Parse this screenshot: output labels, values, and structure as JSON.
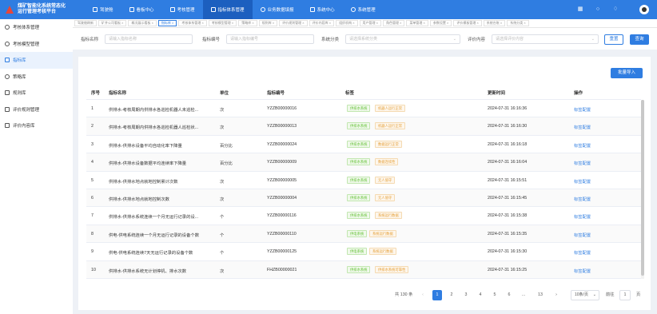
{
  "app": {
    "logo_line1": "煤矿智能化系统常态化",
    "logo_line2": "运行管理考核平台"
  },
  "nav": [
    {
      "label": "驾驶舱",
      "icon": "monitor-icon"
    },
    {
      "label": "看板中心",
      "icon": "dashboard-icon"
    },
    {
      "label": "考核管理",
      "icon": "clipboard-icon"
    },
    {
      "label": "指标体系管理",
      "icon": "list-icon"
    },
    {
      "label": "业务数据填报",
      "icon": "form-icon"
    },
    {
      "label": "系统中心",
      "icon": "layers-icon"
    },
    {
      "label": "系统管理",
      "icon": "gear-icon"
    }
  ],
  "sidebar": [
    {
      "label": "考核体系管理",
      "icon": "gear-icon"
    },
    {
      "label": "考核模型管理",
      "icon": "gear-icon"
    },
    {
      "label": "指标库",
      "icon": "document-icon"
    },
    {
      "label": "策略库",
      "icon": "share-icon"
    },
    {
      "label": "规则库",
      "icon": "rule-icon"
    },
    {
      "label": "评价规则管理",
      "icon": "sliders-icon"
    },
    {
      "label": "评价内容库",
      "icon": "list-icon"
    }
  ],
  "tabs": [
    "驾驶舱刷新",
    "矿井公司看板 ×",
    "概况展示看板 ×",
    "指标库 ×",
    "考核体系管理 ×",
    "考核模型管理 ×",
    "策略库 ×",
    "规则库 ×",
    "评价规则管理 ×",
    "评价内容库 ×",
    "组织机构 ×",
    "用户管理 ×",
    "角色管理 ×",
    "菜单管理 ×",
    "参数设置 ×",
    "评价模板管理 ×",
    "系统台账 ×",
    "系统分类 ×"
  ],
  "filters": {
    "name_label": "指标名称",
    "name_placeholder": "请输入指标名称",
    "code_label": "指标编号",
    "code_placeholder": "请输入指标编号",
    "category_label": "系统分类",
    "category_placeholder": "请选择系统分类",
    "content_label": "评价内容",
    "content_placeholder": "请选择评价内容",
    "reset_label": "重置",
    "query_label": "查询"
  },
  "import_label": "批量导入",
  "table": {
    "headers": [
      "序号",
      "指标名称",
      "单位",
      "指标编号",
      "标签",
      "更新时间",
      "操作"
    ],
    "rows": [
      {
        "idx": "1",
        "name": "供排水-考核周期内供排水各巡检机器人未巡检...",
        "unit": "次",
        "code": "YZZB00000016",
        "tags": [
          "供排水系统",
          "机器人运行正常"
        ],
        "time": "2024-07-31 16:16:36",
        "op": "标签配置"
      },
      {
        "idx": "2",
        "name": "供排水-考核周期内供排水各巡检机器人巡检状...",
        "unit": "次",
        "code": "YZZB00000013",
        "tags": [
          "供排水系统",
          "机器人运行正常"
        ],
        "time": "2024-07-31 16:16:30",
        "op": "标签配置"
      },
      {
        "idx": "3",
        "name": "供排水-供排水设备平均自动化率下降量",
        "unit": "百分比",
        "code": "YZZB00000024",
        "tags": [
          "供排水系统",
          "数据运行正常"
        ],
        "time": "2024-07-31 16:16:18",
        "op": "标签配置"
      },
      {
        "idx": "4",
        "name": "供排水-供排水设备数据平均连续率下降量",
        "unit": "百分比",
        "code": "YZZB00000009",
        "tags": [
          "供排水系统",
          "数据连续性"
        ],
        "time": "2024-07-31 16:16:04",
        "op": "标签配置"
      },
      {
        "idx": "5",
        "name": "供排水-供排水地点就地控制累计次数",
        "unit": "次",
        "code": "YZZB00000005",
        "tags": [
          "供排水系统",
          "无人值守"
        ],
        "time": "2024-07-31 16:15:51",
        "op": "标签配置"
      },
      {
        "idx": "6",
        "name": "供排水-供排水地点就地控制次数",
        "unit": "次",
        "code": "YZZB00000004",
        "tags": [
          "供排水系统",
          "无人值守"
        ],
        "time": "2024-07-31 16:15:45",
        "op": "标签配置"
      },
      {
        "idx": "7",
        "name": "供排水-供排水系统连续一个月无运行记录的设...",
        "unit": "个",
        "code": "YZZB00000116",
        "tags": [
          "供排水系统",
          "系统运行数据"
        ],
        "time": "2024-07-31 16:15:38",
        "op": "标签配置"
      },
      {
        "idx": "8",
        "name": "供电-供电系统连续一个月无运行记录的设备个数",
        "unit": "个",
        "code": "YZZB00000110",
        "tags": [
          "供电系统",
          "系统运行数据"
        ],
        "time": "2024-07-31 16:15:35",
        "op": "标签配置"
      },
      {
        "idx": "9",
        "name": "供电-供电系统连续7天无运行记录的设备个数",
        "unit": "个",
        "code": "YZZB00000125",
        "tags": [
          "供电系统",
          "系统运行数据"
        ],
        "time": "2024-07-31 16:15:30",
        "op": "标签配置"
      },
      {
        "idx": "10",
        "name": "供排水-供排水系统无计划停机、排水次数",
        "unit": "次",
        "code": "FHZB00000021",
        "tags": [
          "供排水系统",
          "供排水系统可靠性"
        ],
        "time": "2024-07-31 16:15:25",
        "op": "标签配置"
      }
    ]
  },
  "pagination": {
    "total": "共 130 条",
    "pages": [
      "1",
      "2",
      "3",
      "4",
      "5",
      "6",
      "…",
      "13"
    ],
    "prev": "‹",
    "next": "›",
    "page_size": "10条/页",
    "goto_label": "前往",
    "goto_value": "1",
    "page_unit": "页"
  },
  "colors": {
    "primary": "#2f7de1",
    "tag_green": "#67c23a",
    "tag_orange": "#e6a23c"
  }
}
